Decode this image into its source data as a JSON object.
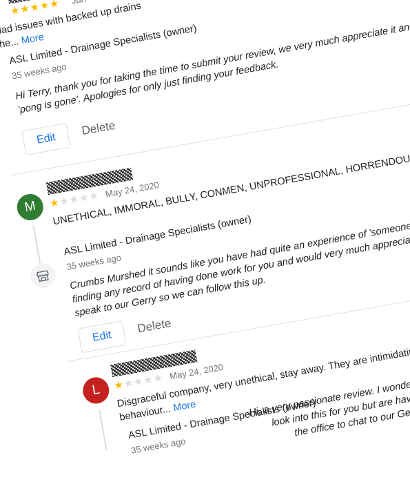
{
  "reviews": [
    {
      "stars": [
        "★",
        "★",
        "★",
        "★",
        "★"
      ],
      "stars_filled": 5,
      "date": "Jun",
      "text_lines": [
        "Had issues with backed up drains"
      ],
      "text_tail": "the...",
      "more": "More",
      "owner": {
        "name": "ASL Limited - Drainage Specialists (owner)",
        "time": "35 weeks ago",
        "reply_lines": [
          "Hi Terry, thank you for taking the time to submit your review, we very much appreciate it and are",
          "'pong is gone'. Apologies for only just finding your feedback."
        ]
      },
      "edit": "Edit",
      "delete": "Delete"
    },
    {
      "avatar_letter": "M",
      "avatar_color": "#2e7d32",
      "stars": [
        "★",
        "★",
        "★",
        "★",
        "★"
      ],
      "stars_filled": 1,
      "date": "May 24, 2020",
      "text_lines": [
        "UNETHICAL, IMMORAL, BULLY, CONMEN, UNPROFESSIONAL, HORRENDOUS, AWFUL, UNSCRUPULOUS"
      ],
      "owner": {
        "name": "ASL Limited - Drainage Specialists (owner)",
        "time": "35 weeks ago",
        "reply_lines": [
          "Crumbs Murshed it sounds like you have had quite an experience of 'someone's company'",
          "finding any record of having done work for you and would very much appreciate you",
          "speak to our Gerry so we can follow this up."
        ]
      },
      "edit": "Edit",
      "delete": "Delete"
    },
    {
      "avatar_letter": "L",
      "avatar_color": "#c5221f",
      "stars": [
        "★",
        "★",
        "★",
        "★",
        "★"
      ],
      "stars_filled": 1,
      "date": "May 24, 2020",
      "text_lines": [
        "Disgraceful company, very unethical, stay away. They are intimidating and use"
      ],
      "text_tail": "behaviour...",
      "more": "More",
      "owner": {
        "name": "ASL Limited - Drainage Specialists (owner)",
        "time": "35 weeks ago",
        "reply_lines": [
          "Hi, a very passionate review. I wonder did you make contact",
          "look into this for you but are having diff",
          "the office to chat to our Gerry"
        ]
      }
    }
  ]
}
